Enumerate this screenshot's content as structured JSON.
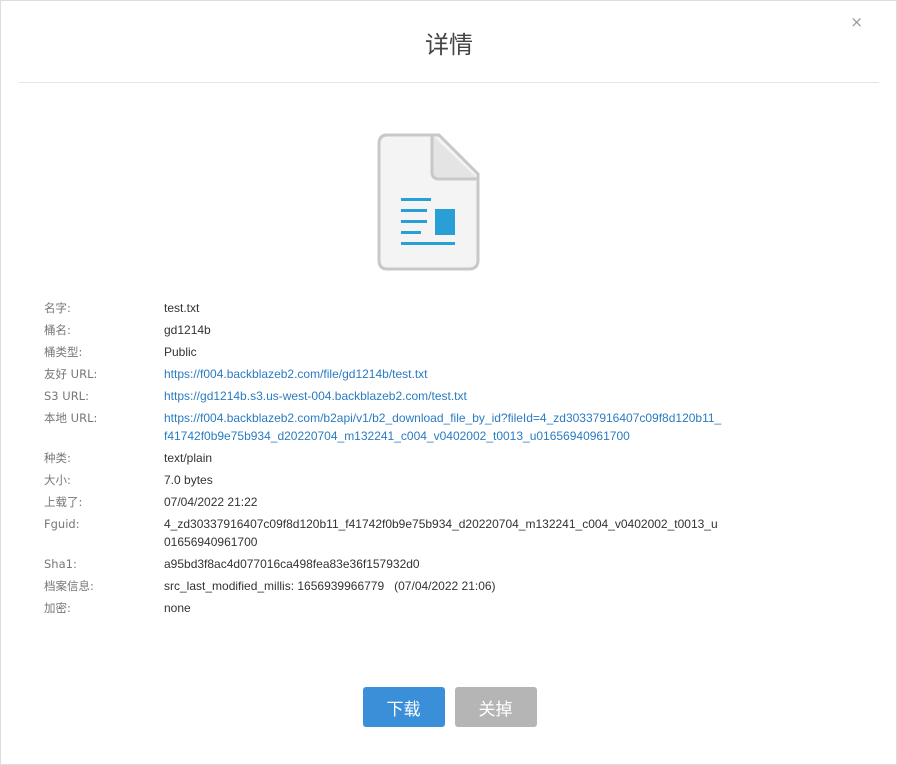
{
  "dialog": {
    "title": "详情",
    "close_symbol": "×"
  },
  "icon": {
    "name": "document-icon",
    "accent": "#2a9fd6"
  },
  "details": [
    {
      "label": "名字:",
      "value": "test.txt",
      "link": false
    },
    {
      "label": "桶名:",
      "value": "gd1214b",
      "link": false
    },
    {
      "label": "桶类型:",
      "value": "Public",
      "link": false
    },
    {
      "label": "友好 URL:",
      "value": "https://f004.backblazeb2.com/file/gd1214b/test.txt",
      "link": true
    },
    {
      "label": "S3 URL:",
      "value": "https://gd1214b.s3.us-west-004.backblazeb2.com/test.txt",
      "link": true
    },
    {
      "label": "本地 URL:",
      "value": "https://f004.backblazeb2.com/b2api/v1/b2_download_file_by_id?fileId=4_zd30337916407c09f8d120b11_f41742f0b9e75b934_d20220704_m132241_c004_v0402002_t0013_u01656940961700",
      "link": true
    },
    {
      "label": "种类:",
      "value": "text/plain",
      "link": false
    },
    {
      "label": "大小:",
      "value": "7.0 bytes",
      "link": false
    },
    {
      "label": "上载了:",
      "value": "07/04/2022 21:22",
      "link": false
    },
    {
      "label": "Fguid:",
      "value": "4_zd30337916407c09f8d120b11_f41742f0b9e75b934_d20220704_m132241_c004_v0402002_t0013_u01656940961700",
      "link": false
    },
    {
      "label": "Sha1:",
      "value": "a95bd3f8ac4d077016ca498fea83e36f157932d0",
      "link": false
    },
    {
      "label": "档案信息:",
      "value": "src_last_modified_millis: 1656939966779   (07/04/2022 21:06)",
      "link": false
    },
    {
      "label": "加密:",
      "value": "none",
      "link": false
    }
  ],
  "buttons": {
    "download": "下载",
    "close": "关掉"
  },
  "colors": {
    "primary_button": "#3a8fd8",
    "secondary_button": "#b5b5b5",
    "link": "#2a7bc2"
  }
}
